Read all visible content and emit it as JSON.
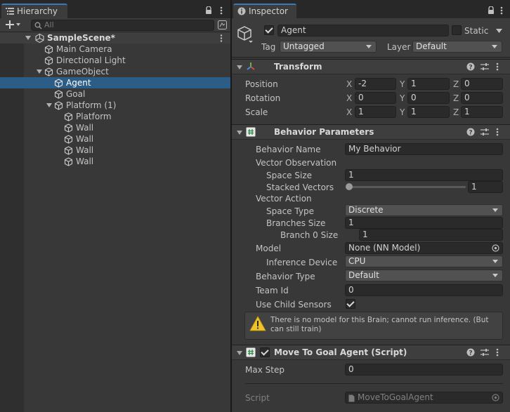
{
  "hierarchy": {
    "tab_label": "Hierarchy",
    "search_placeholder": "All",
    "scene_name": "SampleScene*",
    "items": {
      "main_camera": "Main Camera",
      "directional_light": "Directional Light",
      "gameobject": "GameObject",
      "agent": "Agent",
      "goal": "Goal",
      "platform_group": "Platform (1)",
      "platform": "Platform",
      "wall1": "Wall",
      "wall2": "Wall",
      "wall3": "Wall",
      "wall4": "Wall"
    }
  },
  "inspector": {
    "tab_label": "Inspector",
    "object_name": "Agent",
    "object_active": true,
    "static_label": "Static",
    "tag_label": "Tag",
    "tag_value": "Untagged",
    "layer_label": "Layer",
    "layer_value": "Default",
    "transform": {
      "title": "Transform",
      "position_label": "Position",
      "rotation_label": "Rotation",
      "scale_label": "Scale",
      "axis_x": "X",
      "axis_y": "Y",
      "axis_z": "Z",
      "position": {
        "x": "-2",
        "y": "1",
        "z": "0"
      },
      "rotation": {
        "x": "0",
        "y": "0",
        "z": "0"
      },
      "scale": {
        "x": "1",
        "y": "1",
        "z": "1"
      }
    },
    "behavior": {
      "title": "Behavior Parameters",
      "behavior_name_label": "Behavior Name",
      "behavior_name": "My Behavior",
      "vector_observation_label": "Vector Observation",
      "space_size_label": "Space Size",
      "space_size": "1",
      "stacked_vectors_label": "Stacked Vectors",
      "stacked_vectors": "1",
      "vector_action_label": "Vector Action",
      "space_type_label": "Space Type",
      "space_type": "Discrete",
      "branches_size_label": "Branches Size",
      "branches_size": "1",
      "branch0_label": "Branch 0 Size",
      "branch0": "1",
      "model_label": "Model",
      "model": "None (NN Model)",
      "inference_device_label": "Inference Device",
      "inference_device": "CPU",
      "behavior_type_label": "Behavior Type",
      "behavior_type": "Default",
      "team_id_label": "Team Id",
      "team_id": "0",
      "use_child_sensors_label": "Use Child Sensors",
      "use_child_sensors": true,
      "warning": "There is no model for this Brain; cannot run inference. (But can still train)"
    },
    "move_to_goal": {
      "title": "Move To Goal Agent (Script)",
      "enabled": true,
      "max_step_label": "Max Step",
      "max_step": "0",
      "script_label": "Script",
      "script_value": "MoveToGoalAgent"
    }
  },
  "colors": {
    "panel_bg": "#383838",
    "selection": "#2c5d87",
    "tab_accent": "#3a79bb",
    "warning": "#f0c22a"
  },
  "icons": {
    "hierarchy_tab": "list-icon",
    "inspector_tab": "info-icon",
    "lock": "lock-icon",
    "kebab": "kebab-menu-icon",
    "add": "plus-icon",
    "search": "search-icon",
    "gameobject": "cube-icon",
    "unity_scene": "unity-logo-icon",
    "transform": "transform-axes-icon",
    "script": "script-hash-icon",
    "help": "help-icon",
    "presets": "sliders-icon",
    "warning": "warning-icon",
    "object_picker": "target-icon"
  }
}
